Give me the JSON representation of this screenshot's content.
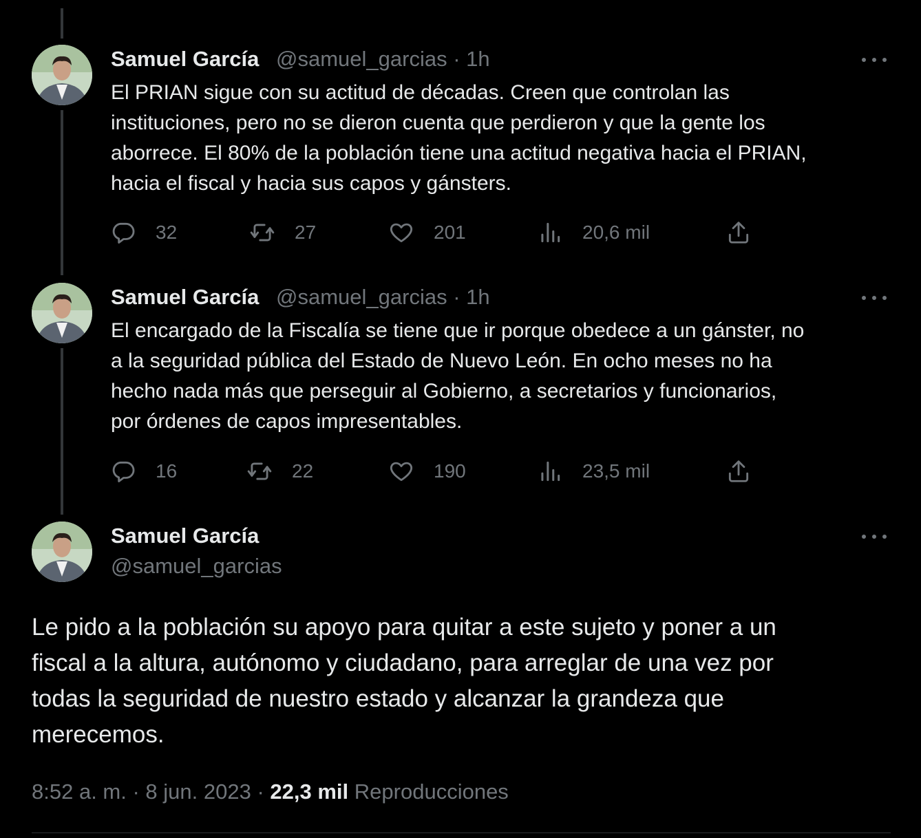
{
  "tweets": [
    {
      "name": "Samuel García",
      "handle": "@samuel_garcias",
      "time": "· 1h",
      "text": "El PRIAN sigue con su actitud de décadas. Creen que controlan las\ninstituciones, pero no se dieron cuenta que perdieron y que la gente los\naborrece. El 80% de la población tiene una actitud negativa hacia el PRIAN,\nhacia el fiscal y hacia sus capos y gánsters.",
      "replies": "32",
      "retweets": "27",
      "likes": "201",
      "views": "20,6 mil"
    },
    {
      "name": "Samuel García",
      "handle": "@samuel_garcias",
      "time": "· 1h",
      "text": "El encargado de la Fiscalía se tiene que ir porque obedece a un gánster, no\na la seguridad pública del Estado de Nuevo León. En ocho meses no ha\nhecho nada más que perseguir al Gobierno, a secretarios y funcionarios,\npor órdenes de capos impresentables.",
      "replies": "16",
      "retweets": "22",
      "likes": "190",
      "views": "23,5 mil"
    }
  ],
  "main_tweet": {
    "name": "Samuel García",
    "handle": "@samuel_garcias",
    "text": "Le pido a la población su apoyo para quitar a este sujeto y poner a un\nfiscal a la altura, autónomo y ciudadano, para arreglar de una vez por\ntodas la seguridad de nuestro estado y alcanzar la grandeza que\nmerecemos.",
    "time": "8:52 a. m.",
    "date": "8 jun. 2023",
    "views_count": "22,3 mil",
    "views_label": "Reproducciones"
  },
  "icons": {
    "reply": "reply-icon",
    "retweet": "retweet-icon",
    "like": "heart-icon",
    "views": "views-icon",
    "share": "share-icon",
    "more": "more-icon"
  },
  "colors": {
    "background": "#000000",
    "text": "#e7e9ea",
    "muted": "#71767b",
    "thread_line": "#333639"
  }
}
